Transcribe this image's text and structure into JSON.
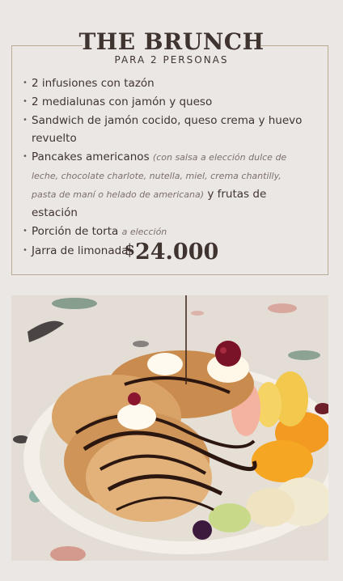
{
  "menu": {
    "title": "THE BRUNCH",
    "subtitle": "PARA 2 PERSONAS",
    "items": [
      {
        "text": "2 infusiones con tazón"
      },
      {
        "text": "2 medialunas con jamón y queso"
      },
      {
        "text": "Sandwich de jamón cocido, queso crema y huevo revuelto"
      },
      {
        "text": "Pancakes americanos",
        "note": "(con salsa a elección dulce de leche, chocolate charlote, nutella, miel, crema chantilly, pasta de maní o helado de americana)",
        "extra": "y frutas de estación"
      },
      {
        "text": "Porción de torta",
        "note": "a elección"
      },
      {
        "text": "Jarra de limonada"
      }
    ],
    "price_symbol": "$",
    "price_value": "24.000"
  },
  "colors": {
    "background": "#ebe7e5",
    "text": "#3f3430",
    "frame": "#b8aa93"
  },
  "photo": {
    "icon": "pancakes-fruit-photo"
  }
}
